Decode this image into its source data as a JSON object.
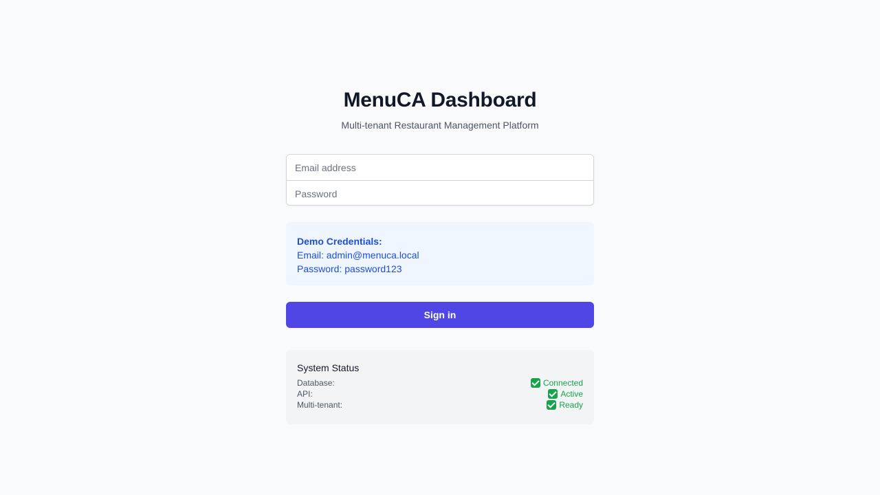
{
  "header": {
    "title": "MenuCA Dashboard",
    "subtitle": "Multi-tenant Restaurant Management Platform"
  },
  "form": {
    "email_placeholder": "Email address",
    "email_value": "",
    "password_placeholder": "Password",
    "password_value": ""
  },
  "demo": {
    "title": "Demo Credentials:",
    "email_line": "Email: admin@menuca.local",
    "password_line": "Password: password123"
  },
  "signin_label": "Sign in",
  "status": {
    "title": "System Status",
    "rows": [
      {
        "label": "Database:",
        "value": "Connected",
        "icon": "check-icon"
      },
      {
        "label": "API:",
        "value": "Active",
        "icon": "check-icon"
      },
      {
        "label": "Multi-tenant:",
        "value": "Ready",
        "icon": "check-icon"
      }
    ]
  },
  "colors": {
    "accent": "#4f46e5",
    "info_text": "#1d4ed8",
    "info_bg": "#eff6ff",
    "success": "#16a34a",
    "page_bg": "#f9fafb"
  }
}
